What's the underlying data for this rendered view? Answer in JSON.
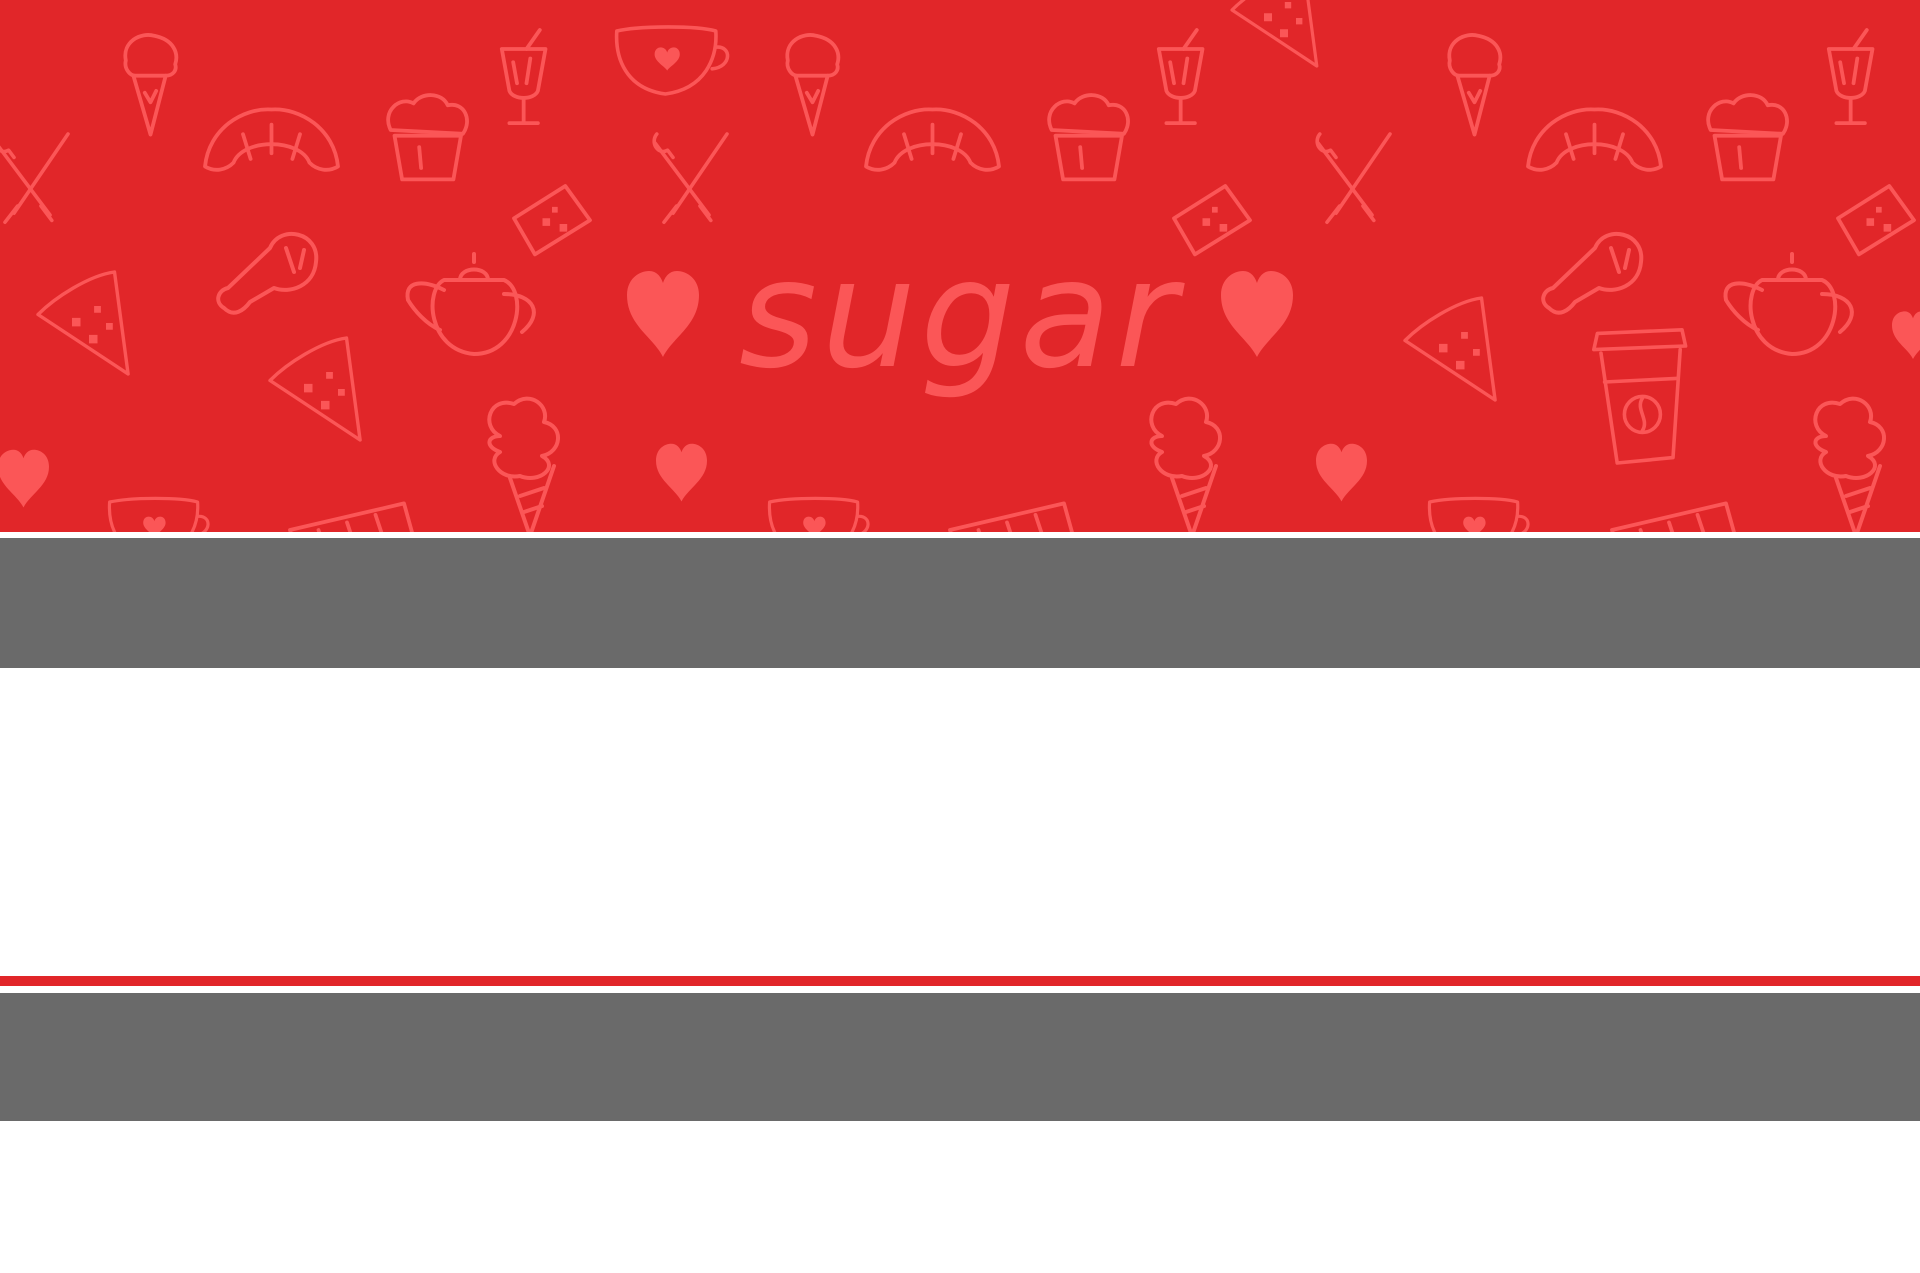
{
  "banner": {
    "brand_text": "sugar",
    "background_color": "#e12629",
    "pattern_color": "#fb5657",
    "icons": [
      "ice-cream-cone-icon",
      "croissant-icon",
      "cupcake-icon",
      "cocktail-glass-icon",
      "teacup-icon",
      "knife-spatula-icon",
      "cake-slice-icon",
      "chicken-leg-icon",
      "teapot-icon",
      "pie-slice-icon",
      "heart-icon",
      "coffee-cup-icon",
      "cake-icon",
      "soft-serve-icon"
    ]
  },
  "layout_colors": {
    "band_grey": "#6a6a6a",
    "accent_red": "#e12629",
    "background_white": "#ffffff"
  }
}
